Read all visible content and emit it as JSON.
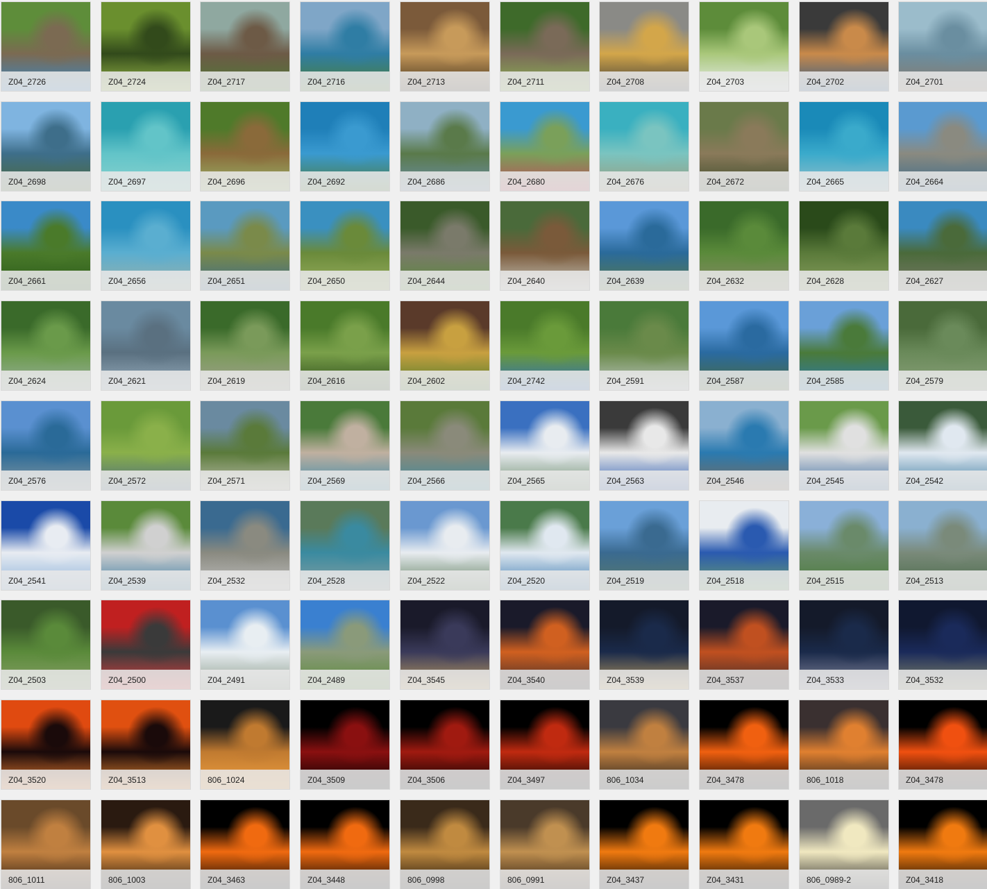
{
  "gallery": {
    "columns": 10,
    "items": [
      {
        "label": "Z04_2726",
        "colors": [
          "#5e8d3a",
          "#7b6a52",
          "#3a88c7"
        ]
      },
      {
        "label": "Z04_2724",
        "colors": [
          "#6a8f2e",
          "#324a1b",
          "#9fbf4a"
        ]
      },
      {
        "label": "Z04_2717",
        "colors": [
          "#8fa8a0",
          "#6d5a46",
          "#4e7a36"
        ]
      },
      {
        "label": "Z04_2716",
        "colors": [
          "#7fa6c7",
          "#2f7da4",
          "#4d7f36"
        ]
      },
      {
        "label": "Z04_2713",
        "colors": [
          "#7b5a3a",
          "#c79a5a",
          "#3a2a1a"
        ]
      },
      {
        "label": "Z04_2711",
        "colors": [
          "#3e6a2a",
          "#7a6a58",
          "#8cb454"
        ]
      },
      {
        "label": "Z04_2708",
        "colors": [
          "#8a8a86",
          "#d3a64a",
          "#3a3a38"
        ]
      },
      {
        "label": "Z04_2703",
        "colors": [
          "#5d8c3a",
          "#a9c77a",
          "#e8eef0"
        ]
      },
      {
        "label": "Z04_2702",
        "colors": [
          "#3a3a3a",
          "#c98a4a",
          "#2a5a8a"
        ]
      },
      {
        "label": "Z04_2701",
        "colors": [
          "#9bbccb",
          "#6a8ea0",
          "#8a7a6a"
        ]
      },
      {
        "label": "Z04_2698",
        "colors": [
          "#7fb4e0",
          "#3e6e8a",
          "#4d6a3a"
        ]
      },
      {
        "label": "Z04_2697",
        "colors": [
          "#2aa0b0",
          "#62c4c8",
          "#8ad2cf"
        ]
      },
      {
        "label": "Z04_2696",
        "colors": [
          "#4f7a2a",
          "#8a6a3a",
          "#9ab86a"
        ]
      },
      {
        "label": "Z04_2692",
        "colors": [
          "#1f7fb8",
          "#3a9ad0",
          "#4d7a3a"
        ]
      },
      {
        "label": "Z04_2686",
        "colors": [
          "#8fb0c4",
          "#5a7a4a",
          "#6a8ea8"
        ]
      },
      {
        "label": "Z04_2680",
        "colors": [
          "#3a9ad0",
          "#7aa05a",
          "#c0485a"
        ]
      },
      {
        "label": "Z04_2676",
        "colors": [
          "#3ab0c0",
          "#7ac4c0",
          "#9a9a7a"
        ]
      },
      {
        "label": "Z04_2672",
        "colors": [
          "#6a7a4a",
          "#8a7a5a",
          "#3a4a2a"
        ]
      },
      {
        "label": "Z04_2665",
        "colors": [
          "#1a8ab8",
          "#3aaacb",
          "#9ac0c8"
        ]
      },
      {
        "label": "Z04_2664",
        "colors": [
          "#5a9ad0",
          "#8a8a80",
          "#3a6a8a"
        ]
      },
      {
        "label": "Z04_2661",
        "colors": [
          "#3a8ac8",
          "#4a7a2a",
          "#2a5a1a"
        ]
      },
      {
        "label": "Z04_2656",
        "colors": [
          "#2a90c0",
          "#5aaed0",
          "#9ab0a8"
        ]
      },
      {
        "label": "Z04_2651",
        "colors": [
          "#5a9ac0",
          "#7a8a4a",
          "#3a6a8a"
        ]
      },
      {
        "label": "Z04_2650",
        "colors": [
          "#3a90c0",
          "#6a8a3a",
          "#9ab060"
        ]
      },
      {
        "label": "Z04_2644",
        "colors": [
          "#3a5a2a",
          "#7a7a6a",
          "#5a8a3a"
        ]
      },
      {
        "label": "Z04_2640",
        "colors": [
          "#4a6a3a",
          "#7a5a3a",
          "#c8c8c0"
        ]
      },
      {
        "label": "Z04_2639",
        "colors": [
          "#5a98d8",
          "#2a6a9a",
          "#5a7a4a"
        ]
      },
      {
        "label": "Z04_2632",
        "colors": [
          "#3a6a2a",
          "#5a8a3a",
          "#8a8a6a"
        ]
      },
      {
        "label": "Z04_2628",
        "colors": [
          "#2a4a1a",
          "#5a7a3a",
          "#8aa060"
        ]
      },
      {
        "label": "Z04_2627",
        "colors": [
          "#3a8ac0",
          "#4a6a3a",
          "#7a7a6a"
        ]
      },
      {
        "label": "Z04_2624",
        "colors": [
          "#3a6a2a",
          "#6a9a4a",
          "#9ab0a0"
        ]
      },
      {
        "label": "Z04_2621",
        "colors": [
          "#6a8aa0",
          "#5a7080",
          "#9ab0c0"
        ]
      },
      {
        "label": "Z04_2619",
        "colors": [
          "#3a6a2a",
          "#7a9a5a",
          "#a0a090"
        ]
      },
      {
        "label": "Z04_2616",
        "colors": [
          "#4a7a2a",
          "#7aa04a",
          "#2a4a1a"
        ]
      },
      {
        "label": "Z04_2602",
        "colors": [
          "#5a3a2a",
          "#c8a040",
          "#4a7a2a"
        ]
      },
      {
        "label": "Z04_2742",
        "colors": [
          "#4a7a2a",
          "#6a9a3a",
          "#2a6ac0"
        ]
      },
      {
        "label": "Z04_2591",
        "colors": [
          "#4a7a3a",
          "#6a8a4a",
          "#c0c8c8"
        ]
      },
      {
        "label": "Z04_2587",
        "colors": [
          "#5a98d8",
          "#2a6aa0",
          "#4a6a3a"
        ]
      },
      {
        "label": "Z04_2585",
        "colors": [
          "#6aa0d8",
          "#4a7a3a",
          "#2a7ab0"
        ]
      },
      {
        "label": "Z04_2579",
        "colors": [
          "#4a6a3a",
          "#6a8a5a",
          "#8aa07a"
        ]
      },
      {
        "label": "Z04_2576",
        "colors": [
          "#5a90d0",
          "#2a6a98",
          "#8a9aa0"
        ]
      },
      {
        "label": "Z04_2572",
        "colors": [
          "#6a9a3a",
          "#8ab04a",
          "#4a6a80"
        ]
      },
      {
        "label": "Z04_2571",
        "colors": [
          "#6a8aa0",
          "#5a7a3a",
          "#c0c0b0"
        ]
      },
      {
        "label": "Z04_2569",
        "colors": [
          "#4a7a3a",
          "#c0b0a0",
          "#3a8aa8"
        ]
      },
      {
        "label": "Z04_2566",
        "colors": [
          "#5a7a3a",
          "#8a8a7a",
          "#3a8aa0"
        ]
      },
      {
        "label": "Z04_2565",
        "colors": [
          "#3a70c0",
          "#e8ecf0",
          "#6a8a6a"
        ]
      },
      {
        "label": "Z04_2563",
        "colors": [
          "#3a3a3a",
          "#e8e8e8",
          "#2a5ab0"
        ]
      },
      {
        "label": "Z04_2546",
        "colors": [
          "#8ab0d0",
          "#2a7ab0",
          "#7a6a5a"
        ]
      },
      {
        "label": "Z04_2545",
        "colors": [
          "#6a9a4a",
          "#e0e0e0",
          "#3a6aa0"
        ]
      },
      {
        "label": "Z04_2542",
        "colors": [
          "#3a5a3a",
          "#e0e8f0",
          "#3a7aa0"
        ]
      },
      {
        "label": "Z04_2541",
        "colors": [
          "#1a4aa8",
          "#e8ecf2",
          "#8ab0d8"
        ]
      },
      {
        "label": "Z04_2539",
        "colors": [
          "#5a8a3a",
          "#d0d0d0",
          "#3a7aa0"
        ]
      },
      {
        "label": "Z04_2532",
        "colors": [
          "#3a6a90",
          "#8a8a80",
          "#c0c0c0"
        ]
      },
      {
        "label": "Z04_2528",
        "colors": [
          "#5a7a5a",
          "#3a8aa0",
          "#8aa0a0"
        ]
      },
      {
        "label": "Z04_2522",
        "colors": [
          "#6a98d0",
          "#e8ecf0",
          "#5a7a5a"
        ]
      },
      {
        "label": "Z04_2520",
        "colors": [
          "#4a7a4a",
          "#e0e8f0",
          "#3a7ab0"
        ]
      },
      {
        "label": "Z04_2519",
        "colors": [
          "#6aa0d8",
          "#3a6a90",
          "#5a7a6a"
        ]
      },
      {
        "label": "Z04_2518",
        "colors": [
          "#e8ecf0",
          "#2a5ab0",
          "#6aa06a"
        ]
      },
      {
        "label": "Z04_2515",
        "colors": [
          "#8ab0d8",
          "#6a8a6a",
          "#4a7a3a"
        ]
      },
      {
        "label": "Z04_2513",
        "colors": [
          "#8ab0d0",
          "#7a8a7a",
          "#4a6a4a"
        ]
      },
      {
        "label": "Z04_2503",
        "colors": [
          "#3a5a2a",
          "#5a8a3a",
          "#8aa06a"
        ]
      },
      {
        "label": "Z04_2500",
        "colors": [
          "#c02020",
          "#3a3a3a",
          "#e04040"
        ]
      },
      {
        "label": "Z04_2491",
        "colors": [
          "#5a90d0",
          "#e8eef2",
          "#8a9a8a"
        ]
      },
      {
        "label": "Z04_2489",
        "colors": [
          "#3a80d0",
          "#8a9a7a",
          "#5a8a3a"
        ]
      },
      {
        "label": "Z04_3545",
        "colors": [
          "#1a1a2a",
          "#3a3a5a",
          "#c0a060"
        ]
      },
      {
        "label": "Z04_3540",
        "colors": [
          "#1a1a2a",
          "#d06020",
          "#3a2a2a"
        ]
      },
      {
        "label": "Z04_3539",
        "colors": [
          "#141a2a",
          "#1a2a4a",
          "#c0a060"
        ]
      },
      {
        "label": "Z04_3537",
        "colors": [
          "#1a1a2a",
          "#c05020",
          "#3a2a2a"
        ]
      },
      {
        "label": "Z04_3533",
        "colors": [
          "#141a2a",
          "#1a2a4a",
          "#8a8aa0"
        ]
      },
      {
        "label": "Z04_3532",
        "colors": [
          "#101830",
          "#1a2a5a",
          "#8a8a6a"
        ]
      },
      {
        "label": "Z04_3520",
        "colors": [
          "#e04a10",
          "#1a0a0a",
          "#f08030"
        ]
      },
      {
        "label": "Z04_3513",
        "colors": [
          "#e05010",
          "#1a0a0a",
          "#f08a30"
        ]
      },
      {
        "label": "806_1024",
        "colors": [
          "#1a1a1a",
          "#c07a30",
          "#f0a040"
        ]
      },
      {
        "label": "Z04_3509",
        "colors": [
          "#000000",
          "#8a1010",
          "#000000"
        ]
      },
      {
        "label": "Z04_3506",
        "colors": [
          "#000000",
          "#a01a10",
          "#000000"
        ]
      },
      {
        "label": "Z04_3497",
        "colors": [
          "#000000",
          "#c02a10",
          "#000000"
        ]
      },
      {
        "label": "806_1034",
        "colors": [
          "#3a3a40",
          "#c08040",
          "#1a1a1a"
        ]
      },
      {
        "label": "Z04_3478",
        "colors": [
          "#000000",
          "#f06010",
          "#000000"
        ]
      },
      {
        "label": "806_1018",
        "colors": [
          "#3a3030",
          "#e08030",
          "#1a1a1a"
        ]
      },
      {
        "label": "Z04_3478",
        "colors": [
          "#000000",
          "#f05010",
          "#000000"
        ]
      },
      {
        "label": "806_1011",
        "colors": [
          "#6a4a2a",
          "#c08040",
          "#2a1a10"
        ]
      },
      {
        "label": "806_1003",
        "colors": [
          "#2a1a10",
          "#e09040",
          "#1a1008"
        ]
      },
      {
        "label": "Z04_3463",
        "colors": [
          "#000000",
          "#f06a10",
          "#000000"
        ]
      },
      {
        "label": "Z04_3448",
        "colors": [
          "#000000",
          "#f06a10",
          "#000000"
        ]
      },
      {
        "label": "806_0998",
        "colors": [
          "#3a2a1a",
          "#c08a40",
          "#1a1008"
        ]
      },
      {
        "label": "806_0991",
        "colors": [
          "#4a3a2a",
          "#c09050",
          "#2a1a10"
        ]
      },
      {
        "label": "Z04_3437",
        "colors": [
          "#000000",
          "#f07a10",
          "#000000"
        ]
      },
      {
        "label": "Z04_3431",
        "colors": [
          "#000000",
          "#f07a10",
          "#000000"
        ]
      },
      {
        "label": "806_0989-2",
        "colors": [
          "#6a6a6a",
          "#f0e8c0",
          "#2a2a2a"
        ]
      },
      {
        "label": "Z04_3418",
        "colors": [
          "#000000",
          "#f07a10",
          "#000000"
        ]
      }
    ]
  }
}
